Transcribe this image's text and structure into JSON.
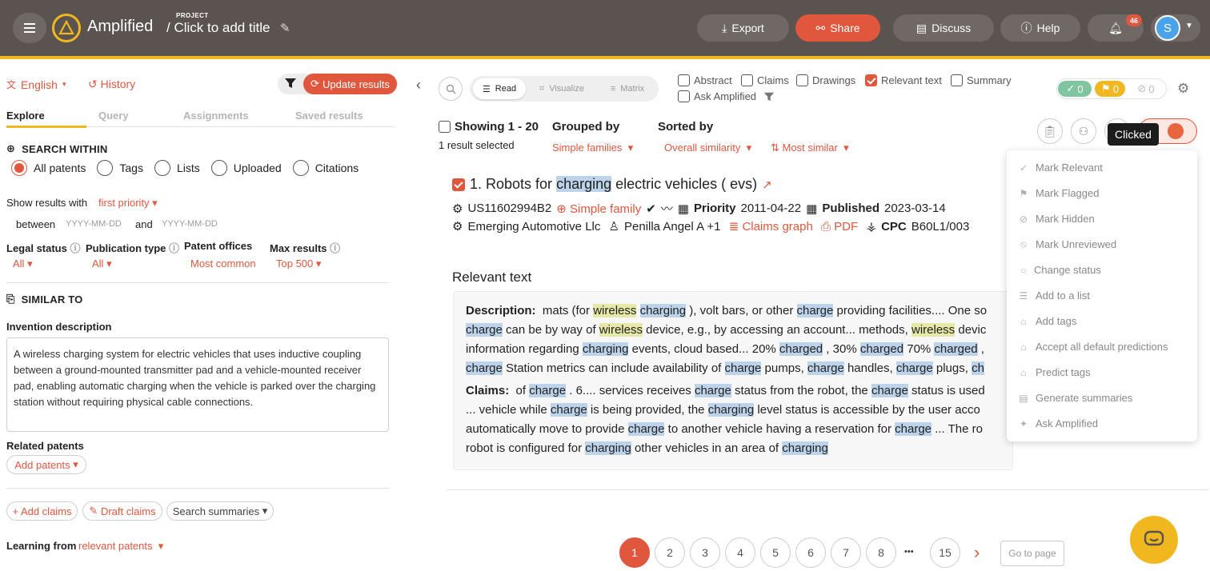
{
  "header": {
    "app_name": "Amplified",
    "project_label": "PROJECT",
    "project_title": "/ Click to add title",
    "buttons": {
      "export": "Export",
      "share": "Share",
      "discuss": "Discuss",
      "help": "Help"
    },
    "notifications_count": "46",
    "avatar_initial": "S"
  },
  "left": {
    "language": "English",
    "history": "History",
    "update_results": "Update results",
    "tabs": [
      "Explore",
      "Query",
      "Assignments",
      "Saved results"
    ],
    "search_within": {
      "title": "SEARCH WITHIN",
      "options": [
        "All patents",
        "Tags",
        "Lists",
        "Uploaded",
        "Citations"
      ],
      "selected": "All patents"
    },
    "show_results_with": "Show results with",
    "first_priority": "first priority",
    "between": "between",
    "date_placeholder": "YYYY-MM-DD",
    "and": "and",
    "filters": [
      {
        "label": "Legal status",
        "value": "All"
      },
      {
        "label": "Publication type",
        "value": "All"
      },
      {
        "label": "Patent offices",
        "value": "Most common"
      },
      {
        "label": "Max results",
        "value": "Top 500"
      }
    ],
    "similar_to": "SIMILAR TO",
    "invention_description_label": "Invention description",
    "invention_description": "A wireless charging system for electric vehicles that uses inductive coupling between a ground-mounted transmitter pad and a vehicle-mounted receiver pad, enabling automatic charging when the vehicle is parked over the charging station without requiring physical cable connections.",
    "related_patents": "Related patents",
    "add_patents": "Add patents",
    "add_claims": "+ Add claims",
    "draft_claims": "Draft claims",
    "search_summaries": "Search summaries",
    "learning_from": "Learning from",
    "relevant_patents": "relevant patents"
  },
  "toolbar": {
    "views": [
      "Read",
      "Visualize",
      "Matrix"
    ],
    "options": [
      {
        "label": "Abstract",
        "checked": false
      },
      {
        "label": "Claims",
        "checked": false
      },
      {
        "label": "Drawings",
        "checked": false
      },
      {
        "label": "Relevant text",
        "checked": true
      },
      {
        "label": "Summary",
        "checked": false
      },
      {
        "label": "Ask Amplified",
        "checked": false
      }
    ],
    "status_counts": {
      "relevant": "0",
      "flagged": "0",
      "hidden": "0"
    }
  },
  "results_header": {
    "showing": "Showing 1 - 20",
    "selected": "1 result selected",
    "grouped_by": "Grouped by",
    "grouped_value": "Simple families",
    "sorted_by": "Sorted by",
    "sorted_value": "Overall similarity",
    "order_value": "Most similar",
    "tooltip": "Clicked"
  },
  "result": {
    "title_pre": "1. Robots for ",
    "title_hl": "charging",
    "title_post": " electric vehicles ( evs)",
    "number": "US11602994B2",
    "simple_family": "Simple family",
    "priority_label": "Priority",
    "priority_date": "2011-04-22",
    "published_label": "Published",
    "published_date": "2023-03-14",
    "assignee": "Emerging Automotive Llc",
    "inventor": "Penilla Angel A +1",
    "claims_graph": "Claims graph",
    "pdf": "PDF",
    "cpc_label": "CPC",
    "cpc": "B60L1/003",
    "relevant_text_heading": "Relevant text",
    "description_label": "Description:",
    "claims_label": "Claims:"
  },
  "actions_menu": [
    {
      "label": "Mark Relevant",
      "icon": "check-icon"
    },
    {
      "label": "Mark Flagged",
      "icon": "flag-icon"
    },
    {
      "label": "Mark Hidden",
      "icon": "eye-slash-icon"
    },
    {
      "label": "Mark Unreviewed",
      "icon": "circle-slash-icon"
    },
    {
      "label": "Change status",
      "icon": "circle-icon"
    },
    {
      "label": "Add to a list",
      "icon": "list-icon"
    },
    {
      "label": "Add tags",
      "icon": "tag-icon"
    },
    {
      "label": "Accept all default predictions",
      "icon": "tag-check-icon"
    },
    {
      "label": "Predict tags",
      "icon": "tag-icon"
    },
    {
      "label": "Generate summaries",
      "icon": "document-icon"
    },
    {
      "label": "Ask Amplified",
      "icon": "sparkle-icon"
    }
  ],
  "pagination": {
    "pages": [
      "1",
      "2",
      "3",
      "4",
      "5",
      "6",
      "7",
      "8"
    ],
    "ellipsis": "•••",
    "last": "15",
    "goto_placeholder": "Go to page"
  },
  "colors": {
    "accent": "#e0573e",
    "header_bg": "#5b5350",
    "brand_yellow": "#f0b81e",
    "highlight_blue": "#bcd3ea",
    "highlight_green": "#e5e8a6"
  }
}
